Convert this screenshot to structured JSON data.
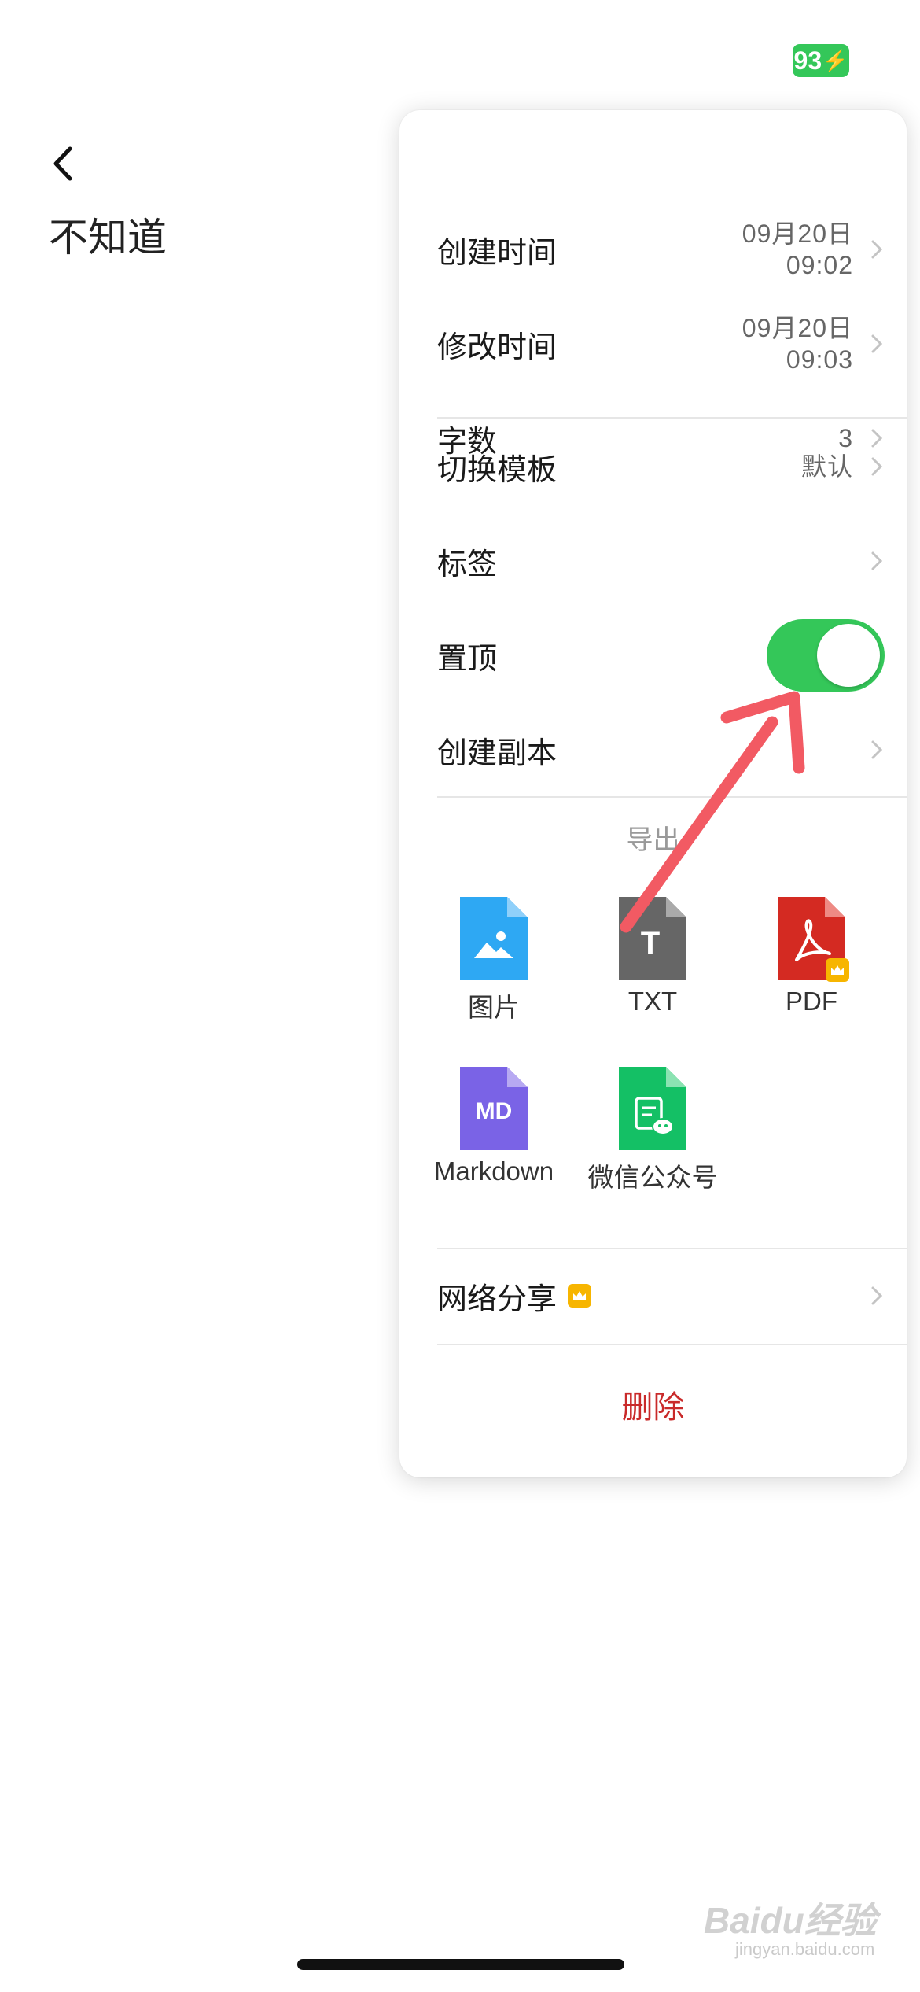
{
  "status_bar": {
    "battery": "93"
  },
  "note": {
    "title": "不知道"
  },
  "menu": {
    "info": [
      {
        "label": "创建时间",
        "value_date": "09月20日",
        "value_time": "09:02"
      },
      {
        "label": "修改时间",
        "value_date": "09月20日",
        "value_time": "09:03"
      },
      {
        "label": "字数",
        "value": "3"
      }
    ],
    "template": {
      "label": "切换模板",
      "value": "默认"
    },
    "tags": {
      "label": "标签"
    },
    "pin": {
      "label": "置顶",
      "enabled": true
    },
    "duplicate": {
      "label": "创建副本"
    },
    "export": {
      "title": "导出",
      "items": [
        {
          "label": "图片",
          "icon": "image-file-icon",
          "color": "#2ea8f3"
        },
        {
          "label": "TXT",
          "icon": "txt-file-icon",
          "icon_text": "T",
          "color": "#666666"
        },
        {
          "label": "PDF",
          "icon": "pdf-file-icon",
          "color": "#d42a22",
          "premium": true
        },
        {
          "label": "Markdown",
          "icon": "markdown-file-icon",
          "icon_text": "MD",
          "color": "#7a63e6"
        },
        {
          "label": "微信公众号",
          "icon": "wechat-file-icon",
          "color": "#14c065"
        }
      ]
    },
    "share": {
      "label": "网络分享",
      "premium": true
    },
    "delete": {
      "label": "删除",
      "color": "#c92a2a"
    }
  },
  "watermark": {
    "brand": "Baidu经验",
    "url": "jingyan.baidu.com"
  },
  "colors": {
    "accent_green": "#34c759",
    "annotation_arrow": "#f25a63"
  }
}
